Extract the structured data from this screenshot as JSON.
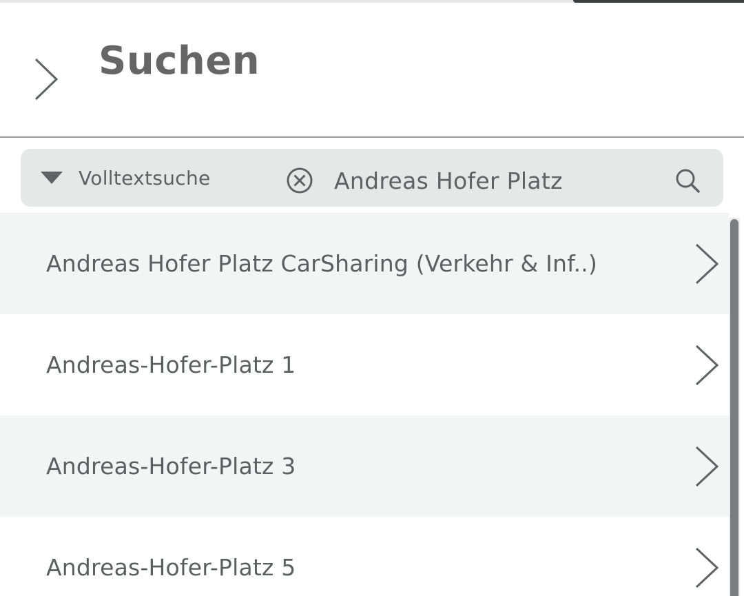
{
  "header": {
    "title": "Suchen",
    "back_icon": "chevron-right-icon"
  },
  "search": {
    "mode_label": "Volltextsuche",
    "mode_icon": "caret-down-icon",
    "clear_icon": "clear-circle-x-icon",
    "query": "Andreas Hofer Platz",
    "search_icon": "magnifier-icon"
  },
  "results": [
    {
      "label": "Andreas Hofer Platz CarSharing (Verkehr & Inf..)"
    },
    {
      "label": "Andreas-Hofer-Platz 1"
    },
    {
      "label": "Andreas-Hofer-Platz 3"
    },
    {
      "label": "Andreas-Hofer-Platz 5"
    }
  ],
  "colors": {
    "title": "#666666",
    "text": "#5c5f60",
    "search_bg": "#e6e7e7",
    "row_shade": "#f3f4f4",
    "divider": "#9a9a9a",
    "scroll_thumb": "#7a7d7e"
  }
}
